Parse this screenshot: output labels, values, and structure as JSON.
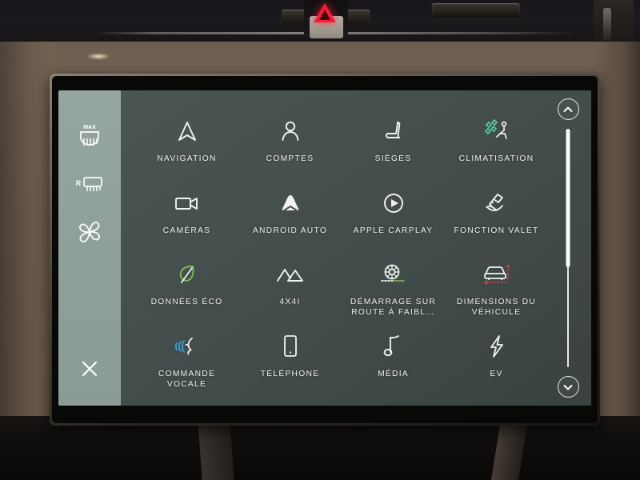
{
  "screen": {
    "type": "vehicle-infotainment-home",
    "background_color": "#434d4a",
    "sidebar_color": "#91a29d",
    "label_color": "#eceeea"
  },
  "climate_sidebar": {
    "items": [
      {
        "name": "max-defrost-front",
        "icon": "max-windshield-defrost-icon",
        "badge": "MAX"
      },
      {
        "name": "rear-defrost",
        "icon": "rear-window-defrost-icon",
        "badge": "R"
      },
      {
        "name": "fan-speed",
        "icon": "fan-icon",
        "badge": ""
      }
    ],
    "close": {
      "label": "close",
      "icon": "close-x-icon"
    }
  },
  "menu": {
    "tiles": [
      {
        "label": "NAVIGATION",
        "icon": "navigation-arrow-icon",
        "accent": "#ffffff"
      },
      {
        "label": "COMPTES",
        "icon": "person-account-icon",
        "accent": "#ffffff"
      },
      {
        "label": "SIÈGES",
        "icon": "car-seat-icon",
        "accent": "#ffffff"
      },
      {
        "label": "CLIMATISATION",
        "icon": "climate-airflow-icon",
        "accent": "#4fd4a0"
      },
      {
        "label": "CAMÉRAS",
        "icon": "video-camera-icon",
        "accent": "#ffffff"
      },
      {
        "label": "ANDROID AUTO",
        "icon": "android-auto-icon",
        "accent": "#ffffff"
      },
      {
        "label": "APPLE CARPLAY",
        "icon": "carplay-play-circle-icon",
        "accent": "#ffffff"
      },
      {
        "label": "FONCTION VALET",
        "icon": "valet-hand-key-icon",
        "accent": "#ffffff"
      },
      {
        "label": "DONNÉES ÉCO",
        "icon": "eco-leaf-icon",
        "accent": "#7cc45a"
      },
      {
        "label": "4X4I",
        "icon": "mountain-terrain-icon",
        "accent": "#ffffff"
      },
      {
        "label": "DÉMARRAGE SUR ROUTE À FAIBL…",
        "icon": "low-friction-launch-wheel-icon",
        "accent": "#6db84a"
      },
      {
        "label": "DIMENSIONS DU VÉHICULE",
        "icon": "vehicle-dimensions-icon",
        "accent": "#d8434a"
      },
      {
        "label": "COMMANDE VOCALE",
        "icon": "voice-command-icon",
        "accent": "#34a5dd"
      },
      {
        "label": "TÉLÉPHONE",
        "icon": "smartphone-icon",
        "accent": "#ffffff"
      },
      {
        "label": "MÉDIA",
        "icon": "music-note-icon",
        "accent": "#ffffff"
      },
      {
        "label": "EV",
        "icon": "lightning-bolt-icon",
        "accent": "#ffffff"
      }
    ]
  },
  "scrollbar": {
    "up": {
      "icon": "chevron-up-icon"
    },
    "down": {
      "icon": "chevron-down-icon"
    },
    "thumb_fraction": 0.58,
    "position": "top"
  },
  "dashboard": {
    "hazard_button": {
      "icon": "hazard-triangle-icon",
      "color": "#ff1a33"
    }
  }
}
